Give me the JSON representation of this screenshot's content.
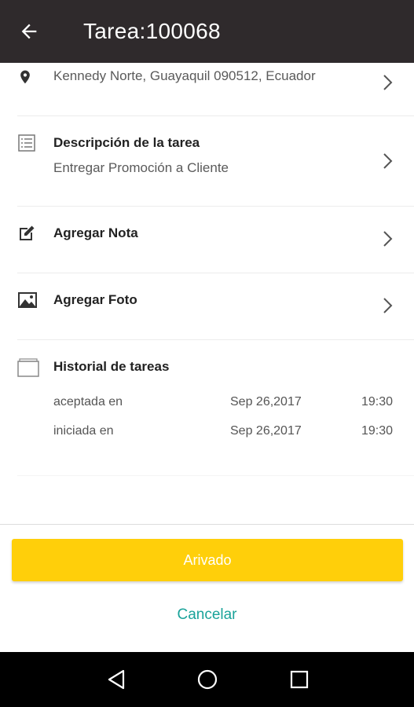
{
  "appbar": {
    "title": "Tarea:100068"
  },
  "address": {
    "text": "Kennedy Norte, Guayaquil 090512, Ecuador"
  },
  "description": {
    "title": "Descripción de la tarea",
    "value": "Entregar Promoción a Cliente"
  },
  "note": {
    "title": "Agregar Nota"
  },
  "photo": {
    "title": "Agregar Foto"
  },
  "history": {
    "title": "Historial de tareas",
    "entries": [
      {
        "label": "aceptada en",
        "date": "Sep 26,2017",
        "time": "19:30"
      },
      {
        "label": "iniciada en",
        "date": "Sep 26,2017",
        "time": "19:30"
      }
    ]
  },
  "actions": {
    "primary_label": "Arivado",
    "cancel_label": "Cancelar"
  },
  "colors": {
    "appbar": "#2f2a2c",
    "primary": "#ffcf0a",
    "cancel": "#1aa39a"
  }
}
